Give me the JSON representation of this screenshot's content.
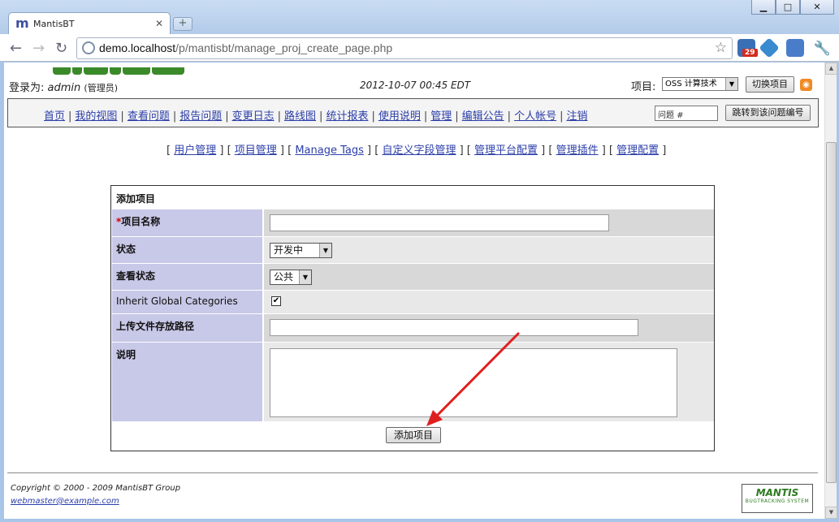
{
  "browser": {
    "tab_title": "MantisBT",
    "tab_favicon": "m",
    "url_host": "demo.localhost",
    "url_path": "/p/mantisbt/manage_proj_create_page.php",
    "extension_badge": "29",
    "window_buttons": {
      "minimize": "▁",
      "maximize": "□",
      "close": "✕"
    }
  },
  "header": {
    "login_label": "登录为:",
    "username": "admin",
    "role": "(管理员)",
    "datetime": "2012-10-07 00:45 EDT",
    "project_label": "项目:",
    "project_selected": "OSS 计算技术",
    "switch_button": "切换项目"
  },
  "menu": {
    "items": [
      "首页",
      "我的视图",
      "查看问题",
      "报告问题",
      "变更日志",
      "路线图",
      "统计报表",
      "使用说明",
      "管理",
      "编辑公告",
      "个人帐号",
      "注销"
    ],
    "bug_placeholder": "问题 #",
    "jump_button": "跳转到该问题编号"
  },
  "manage_links": [
    "用户管理",
    "项目管理",
    "Manage Tags",
    "自定义字段管理",
    "管理平台配置",
    "管理插件",
    "管理配置"
  ],
  "form": {
    "title": "添加项目",
    "fields": {
      "name": {
        "label": "项目名称",
        "required_mark": "*",
        "value": ""
      },
      "status": {
        "label": "状态",
        "value": "开发中"
      },
      "view_status": {
        "label": "查看状态",
        "value": "公共"
      },
      "inherit": {
        "label": "Inherit Global Categories",
        "checked": "✔"
      },
      "file_path": {
        "label": "上传文件存放路径",
        "value": ""
      },
      "description": {
        "label": "说明",
        "value": ""
      }
    },
    "submit_label": "添加项目"
  },
  "footer": {
    "copyright": "Copyright © 2000 - 2009 MantisBT Group",
    "webmaster": "webmaster@example.com",
    "logo_text": "MANTIS",
    "logo_sub": "BUGTRACKING SYSTEM"
  },
  "colors": {
    "link": "#2b3ea8",
    "category_bg": "#c8c8e8",
    "row_dark": "#d8d8d8",
    "row_light": "#e8e8e8",
    "annotation_arrow": "#e02020"
  }
}
